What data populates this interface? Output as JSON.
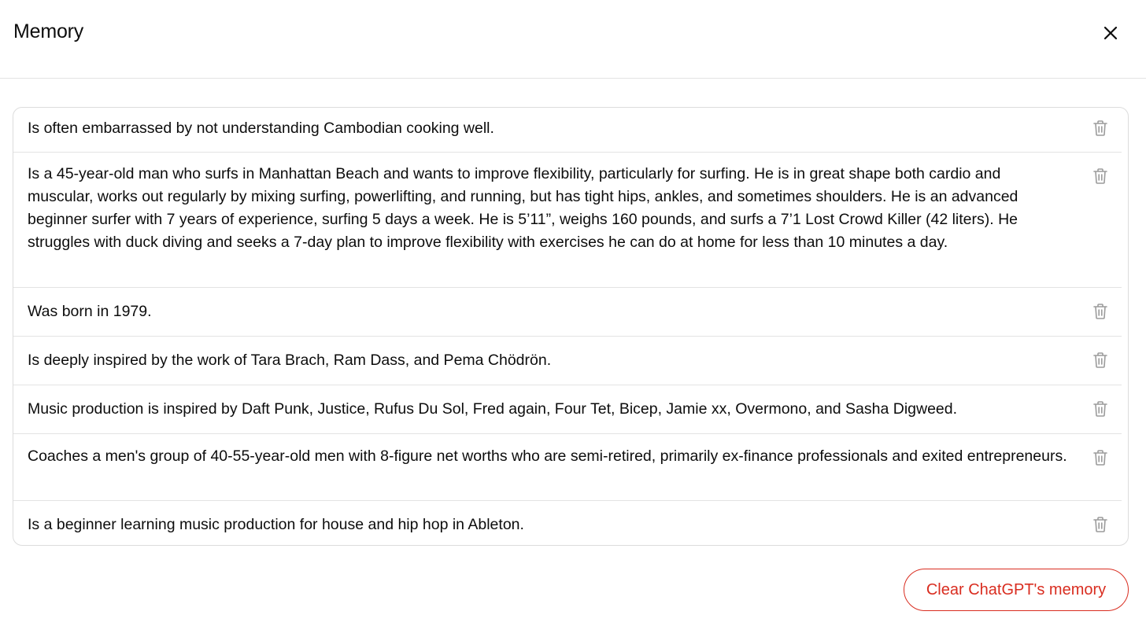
{
  "header": {
    "title": "Memory",
    "close_icon": "close-icon"
  },
  "memories": [
    {
      "text": "Is often embarrassed by not understanding Cambodian cooking well.",
      "icon": "trash-icon"
    },
    {
      "text": "Is a 45-year-old man who surfs in Manhattan Beach and wants to improve flexibility, particularly for surfing. He is in great shape both cardio and muscular, works out regularly by mixing surfing, powerlifting, and running, but has tight hips, ankles, and sometimes shoulders. He is an advanced beginner surfer with 7 years of experience, surfing 5 days a week. He is 5’11”, weighs 160 pounds, and surfs a 7’1 Lost Crowd Killer (42 liters). He struggles with duck diving and seeks a 7-day plan to improve flexibility with exercises he can do at home for less than 10 minutes a day.",
      "icon": "trash-icon"
    },
    {
      "text": "Was born in 1979.",
      "icon": "trash-icon"
    },
    {
      "text": "Is deeply inspired by the work of Tara Brach, Ram Dass, and Pema Chödrön.",
      "icon": "trash-icon"
    },
    {
      "text": "Music production is inspired by Daft Punk, Justice, Rufus Du Sol, Fred again, Four Tet, Bicep, Jamie xx, Overmono, and Sasha Digweed.",
      "icon": "trash-icon"
    },
    {
      "text": "Coaches a men's group of 40-55-year-old men with 8-figure net worths who are semi-retired, primarily ex-finance professionals and exited entrepreneurs.",
      "icon": "trash-icon"
    },
    {
      "text": "Is a beginner learning music production for house and hip hop in Ableton.",
      "icon": "trash-icon"
    }
  ],
  "footer": {
    "clear_label": "Clear ChatGPT's memory"
  },
  "colors": {
    "danger": "#d92d20",
    "text": "#0d0d0d",
    "icon_muted": "#9b9b9b",
    "border": "#e3e3e3"
  }
}
